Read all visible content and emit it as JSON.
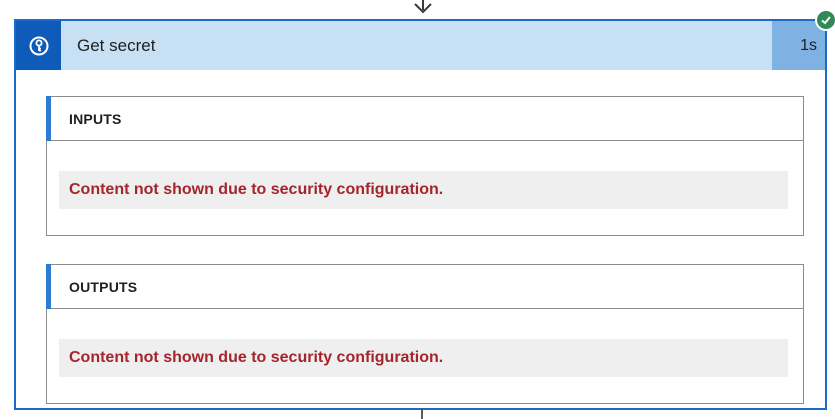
{
  "action": {
    "title": "Get secret",
    "duration": "1s",
    "icon": "key-vault-icon",
    "status_icon": "success-check-icon",
    "colors": {
      "border": "#1b6ac9",
      "header_bg": "#c7e0f4",
      "icon_bg": "#0f5bb9",
      "duration_bg": "#7fb1e3",
      "status": "#2e8b57",
      "message": "#a4262c"
    }
  },
  "inputs": {
    "title": "INPUTS",
    "message": "Content not shown due to security configuration."
  },
  "outputs": {
    "title": "OUTPUTS",
    "message": "Content not shown due to security configuration."
  }
}
